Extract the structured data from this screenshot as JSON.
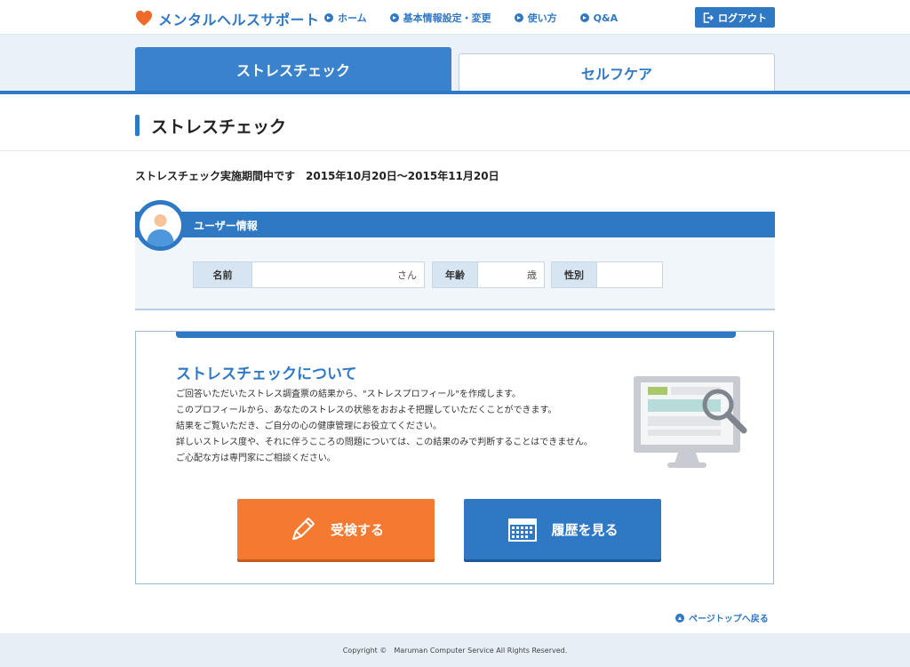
{
  "header": {
    "logo_text": "メンタルヘルスサポート",
    "nav": [
      {
        "label": "ホーム"
      },
      {
        "label": "基本情報設定・変更"
      },
      {
        "label": "使い方"
      },
      {
        "label": "Q&A"
      }
    ],
    "logout_label": "ログアウト"
  },
  "tabs": {
    "active": "ストレスチェック",
    "inactive": "セルフケア"
  },
  "page_title": "ストレスチェック",
  "period_text": "ストレスチェック実施期間中です　2015年10月20日～2015年11月20日",
  "user_info": {
    "heading": "ユーザー情報",
    "name_label": "名前",
    "name_value": "",
    "name_suffix": "さん",
    "age_label": "年齢",
    "age_value": "",
    "age_suffix": "歳",
    "gender_label": "性別",
    "gender_value": ""
  },
  "about": {
    "title": "ストレスチェックについて",
    "lines": [
      "ご回答いただいたストレス調査票の結果から、\"ストレスプロフィール\"を作成します。",
      "このプロフィールから、あなたのストレスの状態をおおよそ把握していただくことができます。",
      "結果をご覧いただき、ご自分の心の健康管理にお役立てください。",
      "詳しいストレス度や、それに伴うこころの問題については、この結果のみで判断することはできません。",
      "ご心配な方は専門家にご相談ください。"
    ],
    "exam_button": "受検する",
    "history_button": "履歴を見る"
  },
  "page_top_label": "ページトップへ戻る",
  "footer_text": "Copyright ©　Maruman Computer Service All Rights Reserved.",
  "colors": {
    "primary": "#2f78c4",
    "accent_orange": "#f57a31",
    "heart": "#f06a2a"
  },
  "icons": {
    "logo": "heart-icon",
    "nav": "circle-arrow-icon",
    "logout": "logout-icon",
    "user": "user-avatar-icon",
    "exam": "pencil-icon",
    "history": "calendar-icon",
    "illustration": "monitor-search-icon",
    "page_top": "arrow-up-circle-icon"
  }
}
